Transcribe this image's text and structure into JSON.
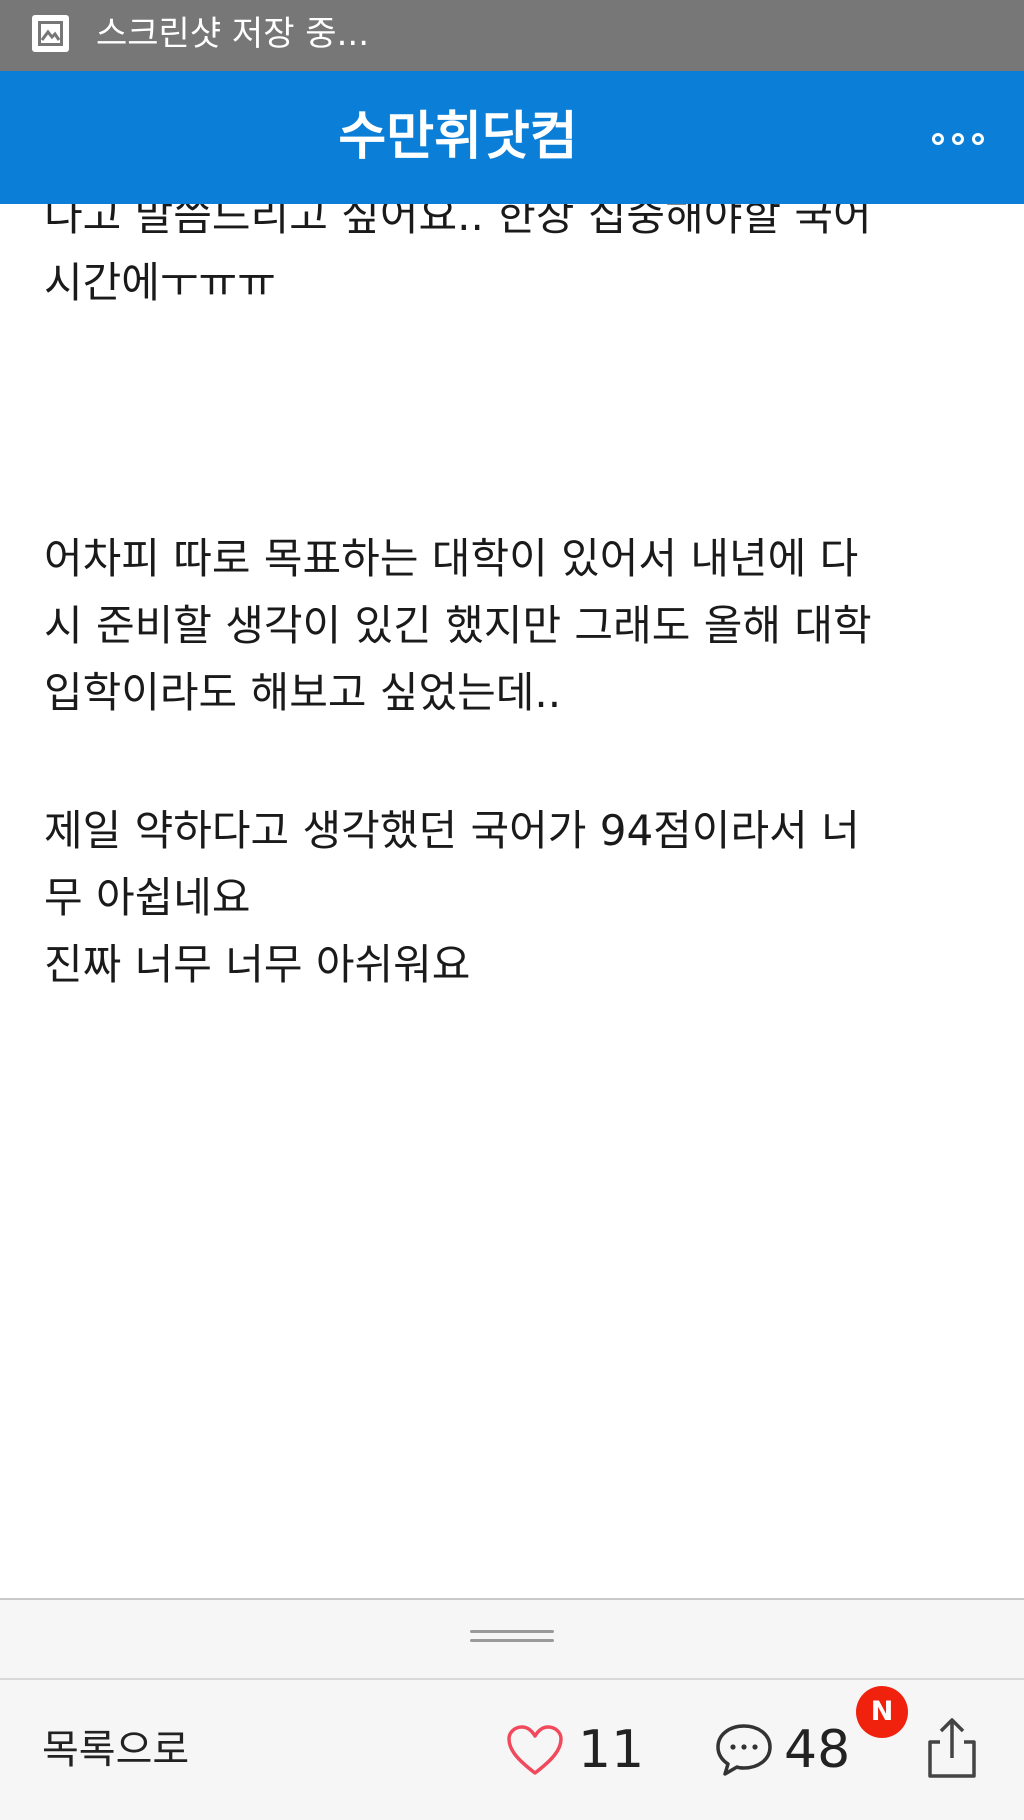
{
  "status_bar": {
    "notification_text": "스크린샷 저장 중...",
    "icon": "image-icon"
  },
  "header": {
    "title": "수만휘닷컴",
    "menu_icon": "more-dots-icon",
    "accent_color": "#0b7fd8"
  },
  "article": {
    "paragraphs": [
      [
        "다고 말씀드리고 싶어요.. 한창 집중해야할 국어",
        "시간에ㅜㅠㅠ"
      ],
      [
        "어차피 따로 목표하는 대학이 있어서 내년에 다",
        "시 준비할 생각이 있긴 했지만 그래도 올해 대학",
        "입학이라도 해보고 싶었는데.."
      ],
      [
        "제일 약하다고 생각했던 국어가 94점이라서 너",
        "무 아쉽네요",
        "진짜 너무 너무 아쉬워요"
      ]
    ]
  },
  "toolbar": {
    "list_label": "목록으로",
    "like_icon": "heart-icon",
    "like_count": "11",
    "comment_icon": "speech-bubble-icon",
    "comment_count": "48",
    "new_badge": "N",
    "badge_color": "#f0220d",
    "share_icon": "share-icon"
  }
}
